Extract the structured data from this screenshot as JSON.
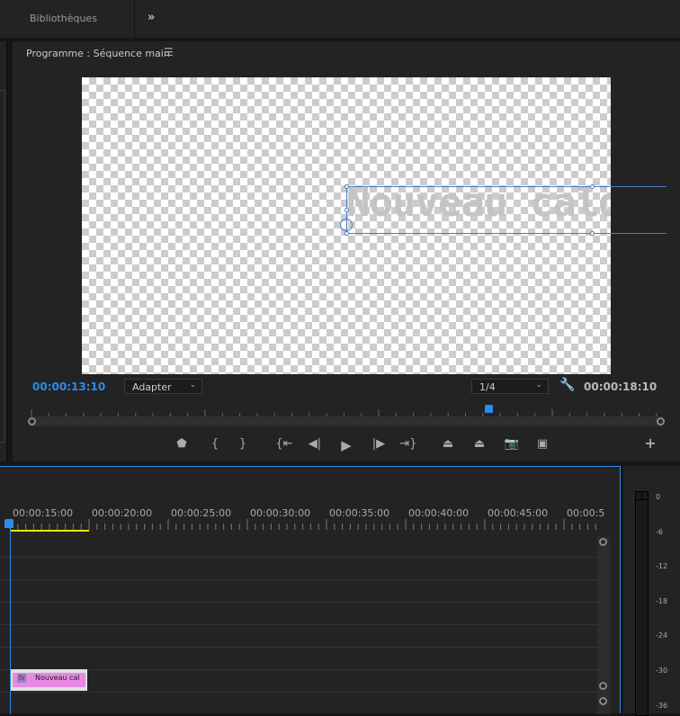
{
  "top_tabs": {
    "libraries": "Bibliothèques",
    "more": "»"
  },
  "program": {
    "title": "Programme : Séquence main",
    "menu_icon": "hamburger-icon",
    "caption": "Nouveau calq",
    "current_time": "00:00:13:10",
    "fit_select": "Adapter",
    "resolution_select": "1/4",
    "duration": "00:00:18:10",
    "playhead_position_fraction": 0.73
  },
  "controls": [
    {
      "name": "add-marker",
      "icon": "marker-icon",
      "glyph": "⬟"
    },
    {
      "name": "mark-in",
      "icon": "mark-in-icon",
      "glyph": "{"
    },
    {
      "name": "mark-out",
      "icon": "mark-out-icon",
      "glyph": "}"
    },
    {
      "name": "go-to-in",
      "icon": "go-to-in-icon",
      "glyph": "{⇤"
    },
    {
      "name": "step-back",
      "icon": "step-back-icon",
      "glyph": "◀|"
    },
    {
      "name": "play",
      "icon": "play-icon",
      "glyph": "▶"
    },
    {
      "name": "step-forward",
      "icon": "step-forward-icon",
      "glyph": "|▶"
    },
    {
      "name": "go-to-out",
      "icon": "go-to-out-icon",
      "glyph": "⇥}"
    },
    {
      "name": "lift",
      "icon": "lift-icon",
      "glyph": "⏏"
    },
    {
      "name": "extract",
      "icon": "extract-icon",
      "glyph": "⏏"
    },
    {
      "name": "export-frame",
      "icon": "camera-icon",
      "glyph": "📷"
    },
    {
      "name": "compare",
      "icon": "compare-view-icon",
      "glyph": "▣"
    },
    {
      "name": "button-editor",
      "icon": "plus-icon",
      "glyph": "+"
    }
  ],
  "timeline": {
    "time_labels": [
      "00:00:15:00",
      "00:00:20:00",
      "00:00:25:00",
      "00:00:30:00",
      "00:00:35:00",
      "00:00:40:00",
      "00:00:45:00",
      "00:00:5"
    ],
    "clip": {
      "label": "Nouveau cal",
      "fx": "fx",
      "color": "#e58ae3"
    }
  },
  "audio_meter": {
    "labels": [
      "0",
      "-6",
      "-12",
      "-18",
      "-24",
      "-30",
      "-36"
    ]
  },
  "colors": {
    "accent": "#2d8ceb",
    "work_area": "#e6e600"
  }
}
